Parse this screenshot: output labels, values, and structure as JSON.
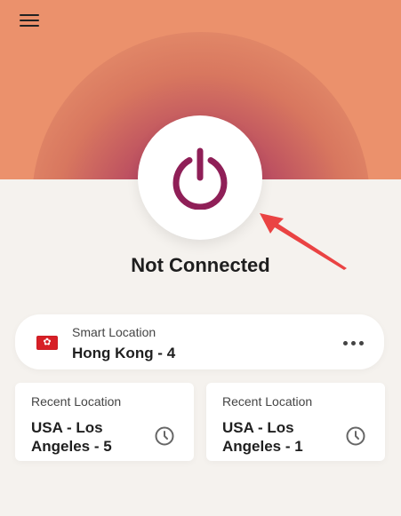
{
  "header": {
    "menu_icon": "menu-icon"
  },
  "connection": {
    "status": "Not Connected",
    "power_icon": "power-icon",
    "colors": {
      "accent": "#8f1f57",
      "hero_outer": "#ef9d74",
      "hero_middle": "#eb916c",
      "annotation": "#ea4343"
    }
  },
  "smart_location": {
    "label": "Smart Location",
    "value": "Hong Kong - 4",
    "flag_icon": "hong-kong-flag-icon",
    "more_icon": "more-options-icon"
  },
  "recent_locations": [
    {
      "label": "Recent Location",
      "value": "USA - Los Angeles - 5",
      "clock_icon": "clock-icon"
    },
    {
      "label": "Recent Location",
      "value": "USA - Los Angeles - 1",
      "clock_icon": "clock-icon"
    }
  ]
}
